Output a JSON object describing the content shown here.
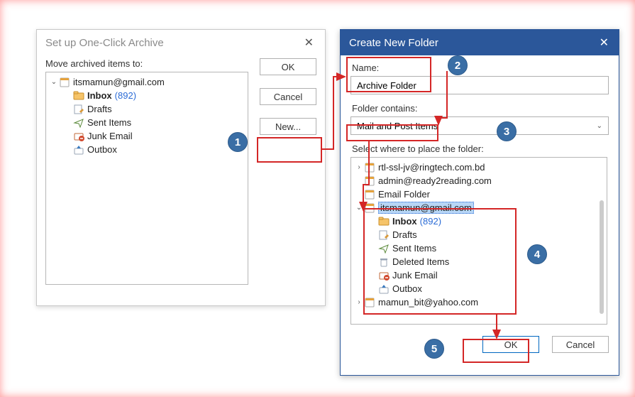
{
  "dialog1": {
    "title": "Set up One-Click Archive",
    "moveLabel": "Move archived items to:",
    "buttons": {
      "ok": "OK",
      "cancel": "Cancel",
      "new": "New..."
    },
    "tree": {
      "account": "itsmamun@gmail.com",
      "inbox": "Inbox",
      "inboxCount": "(892)",
      "drafts": "Drafts",
      "sent": "Sent Items",
      "junk": "Junk Email",
      "outbox": "Outbox"
    }
  },
  "dialog2": {
    "title": "Create New Folder",
    "nameLabel": "Name:",
    "nameValue": "Archive Folder",
    "containsLabel": "Folder contains:",
    "containsValue": "Mail and Post Items",
    "placeLabel": "Select where to place the folder:",
    "buttons": {
      "ok": "OK",
      "cancel": "Cancel"
    },
    "tree": {
      "acc1": "rtl-ssl-jv@ringtech.com.bd",
      "acc2": "admin@ready2reading.com",
      "folder1": "Email Folder",
      "acc3": "itsmamun@gmail.com",
      "inbox": "Inbox",
      "inboxCount": "(892)",
      "drafts": "Drafts",
      "sent": "Sent Items",
      "deleted": "Deleted Items",
      "junk": "Junk Email",
      "outbox": "Outbox",
      "acc4": "mamun_bit@yahoo.com"
    }
  },
  "badges": {
    "b1": "1",
    "b2": "2",
    "b3": "3",
    "b4": "4",
    "b5": "5"
  }
}
